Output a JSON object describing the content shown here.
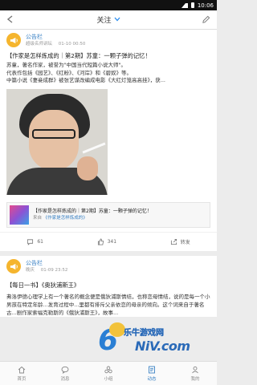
{
  "status_bar": {
    "time": "10:06"
  },
  "header": {
    "title": "关注"
  },
  "posts": [
    {
      "author": "公告栏",
      "sub_label": "超级名师讲坛",
      "time": "01-10 00:50",
      "title": "【作家是怎样炼成的｜第2期】苏童：一颗子弹的记忆！",
      "body": "苏童，著名作家，被誉为\"中国当代短篇小说大师\"。\n代表作包括《园艺》、《红粉》、《河岸》和《碧奴》等。\n中篇小说《妻妾成群》被张艺谋改编成电影《大红灯笼高高挂》，获...",
      "share_title": "【作家是怎样炼成的｜第2期】苏童：一颗子弹的记忆！",
      "share_from_prefix": "来自",
      "share_from_link": "《作家是怎样炼成的》",
      "comments": "61",
      "likes": "341",
      "share_label": "转发"
    },
    {
      "author": "公告栏",
      "sub_label": "晚庆",
      "time": "01-09 23:52",
      "title": "【每日一书】《奥狄浦斯王》",
      "body": "弗洛伊德心理学上有一个著名的概念便是俄狄浦斯情结，也称恋母情结，说的是每一个小男孩在特定年龄...发育过程中...里都有排斥父亲依恋的母亲的倾向。这个词来自于著名古...剧作家索福克勒斯的《俄狄浦斯王》，故事..."
    }
  ],
  "tabs": [
    {
      "label": "首页",
      "icon": "home-icon"
    },
    {
      "label": "消息",
      "icon": "message-icon"
    },
    {
      "label": "小组",
      "icon": "group-icon"
    },
    {
      "label": "动态",
      "icon": "feed-icon"
    },
    {
      "label": "我的",
      "icon": "user-icon"
    }
  ],
  "watermark": {
    "text": "乐牛游戏网",
    "site": "NiV.com",
    "digit": "6"
  },
  "colors": {
    "accent": "#3b82c4",
    "avatar": "#f5b52e"
  }
}
